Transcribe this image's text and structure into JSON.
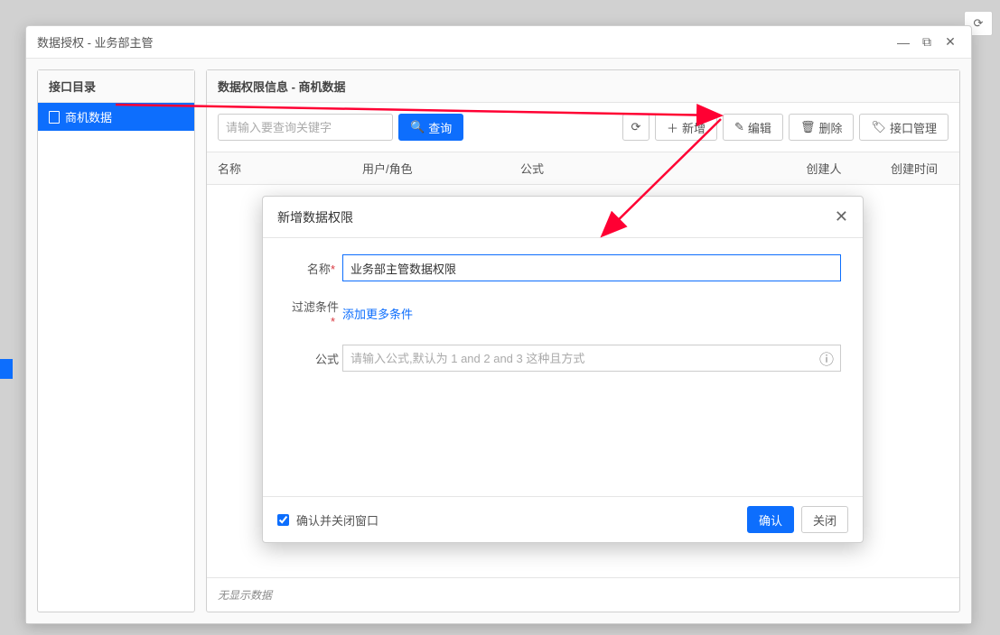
{
  "bg": {
    "refresh_title": "刷新"
  },
  "window": {
    "title": "数据授权 - 业务部主管"
  },
  "sidebar": {
    "header": "接口目录",
    "items": [
      {
        "label": "商机数据"
      }
    ]
  },
  "content": {
    "header": "数据权限信息 - 商机数据",
    "search_placeholder": "请输入要查询关键字",
    "buttons": {
      "search": "查询",
      "add": "新增",
      "edit": "编辑",
      "delete": "删除",
      "api": "接口管理"
    },
    "columns": {
      "name": "名称",
      "user": "用户/角色",
      "formula": "公式",
      "creator": "创建人",
      "time": "创建时间"
    },
    "empty": "无显示数据"
  },
  "dialog": {
    "title": "新增数据权限",
    "fields": {
      "name_label": "名称",
      "name_value": "业务部主管数据权限",
      "filter_label": "过滤条件",
      "filter_link": "添加更多条件",
      "formula_label": "公式",
      "formula_placeholder": "请输入公式,默认为 1 and 2 and 3 这种且方式"
    },
    "footer": {
      "confirm_close": "确认并关闭窗口",
      "ok": "确认",
      "cancel": "关闭"
    }
  }
}
